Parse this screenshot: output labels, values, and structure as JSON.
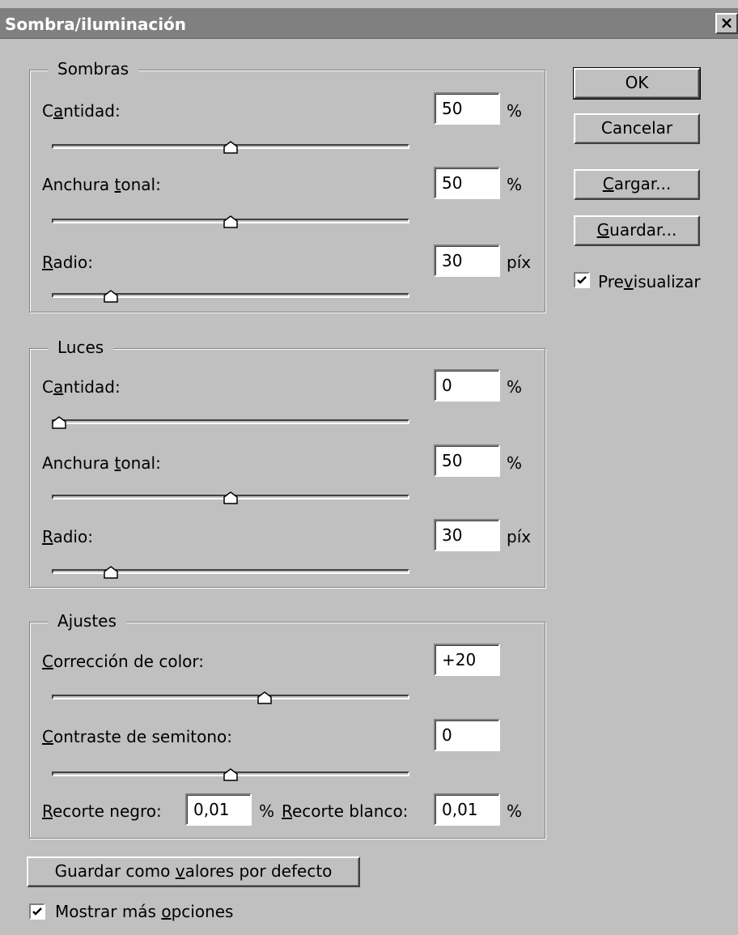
{
  "dialog": {
    "title": "Sombra/iluminación",
    "close_symbol": "×"
  },
  "shadows": {
    "legend": "Sombras",
    "amount": {
      "label": "Cantidad:",
      "value": "50",
      "unit": "%",
      "slider_fraction": 0.5
    },
    "tonal": {
      "label": "Anchura tonal:",
      "value": "50",
      "unit": "%",
      "slider_fraction": 0.5
    },
    "radius": {
      "label": "Radio:",
      "value": "30",
      "unit": "píx",
      "slider_fraction": 0.15
    }
  },
  "highlights": {
    "legend": "Luces",
    "amount": {
      "label": "Cantidad:",
      "value": "0",
      "unit": "%",
      "slider_fraction": 0.0
    },
    "tonal": {
      "label": "Anchura tonal:",
      "value": "50",
      "unit": "%",
      "slider_fraction": 0.5
    },
    "radius": {
      "label": "Radio:",
      "value": "30",
      "unit": "píx",
      "slider_fraction": 0.15
    }
  },
  "adjustments": {
    "legend": "Ajustes",
    "color_correction": {
      "label": "Corrección de color:",
      "value": "+20",
      "slider_fraction": 0.6
    },
    "midtone_contrast": {
      "label": "Contraste de semitono:",
      "value": "0",
      "slider_fraction": 0.5
    },
    "black_clip": {
      "label": "Recorte negro:",
      "value": "0,01",
      "unit": "%"
    },
    "white_clip": {
      "label": "Recorte blanco:",
      "value": "0,01",
      "unit": "%"
    }
  },
  "buttons": {
    "ok": "OK",
    "cancel": "Cancelar",
    "load": "Cargar...",
    "save": "Guardar...",
    "save_defaults": "Guardar como valores por defecto"
  },
  "checkboxes": {
    "preview": {
      "label": "Previsualizar",
      "checked": true
    },
    "more_options": {
      "label": "Mostrar más opciones",
      "checked": true
    }
  },
  "icons": [
    "close-icon",
    "slider-thumb-icon",
    "checkmark-icon"
  ]
}
